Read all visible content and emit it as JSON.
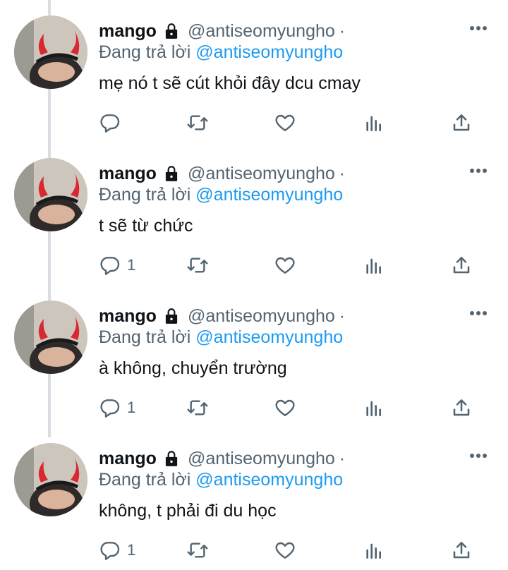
{
  "tweets": [
    {
      "name": "mango",
      "handle": "@antiseomyungho",
      "separator": "·",
      "reply_prefix": "Đang trả lời",
      "reply_mention": "@antiseomyungho",
      "text": "t sẽ từ chức",
      "reply_count": "1"
    },
    {
      "name": "mango",
      "handle": "@antiseomyungho",
      "separator": "·",
      "reply_prefix": "Đang trả lời",
      "reply_mention": "@antiseomyungho",
      "text": "à không, chuyển trường",
      "reply_count": "1"
    },
    {
      "name": "mango",
      "handle": "@antiseomyungho",
      "separator": "·",
      "reply_prefix": "Đang trả lời",
      "reply_mention": "@antiseomyungho",
      "text": "không, t phải đi du học",
      "reply_count": "1"
    },
    {
      "name": "mango",
      "handle": "@antiseomyungho",
      "separator": "·",
      "reply_prefix": "Đang trả lời",
      "reply_mention": "@antiseomyungho",
      "text": "mẹ nó t sẽ cút khỏi đây dcu cmay",
      "reply_count": ""
    }
  ],
  "icons": {
    "lock": "lock-icon",
    "more": "more-icon",
    "reply": "reply-icon",
    "retweet": "retweet-icon",
    "like": "like-icon",
    "views": "views-icon",
    "share": "share-icon"
  },
  "colors": {
    "text": "#0f1419",
    "secondary": "#536471",
    "mention": "#1d9bf0",
    "thread_line": "#d9dee3",
    "avatar_horns": "#d9282f"
  }
}
